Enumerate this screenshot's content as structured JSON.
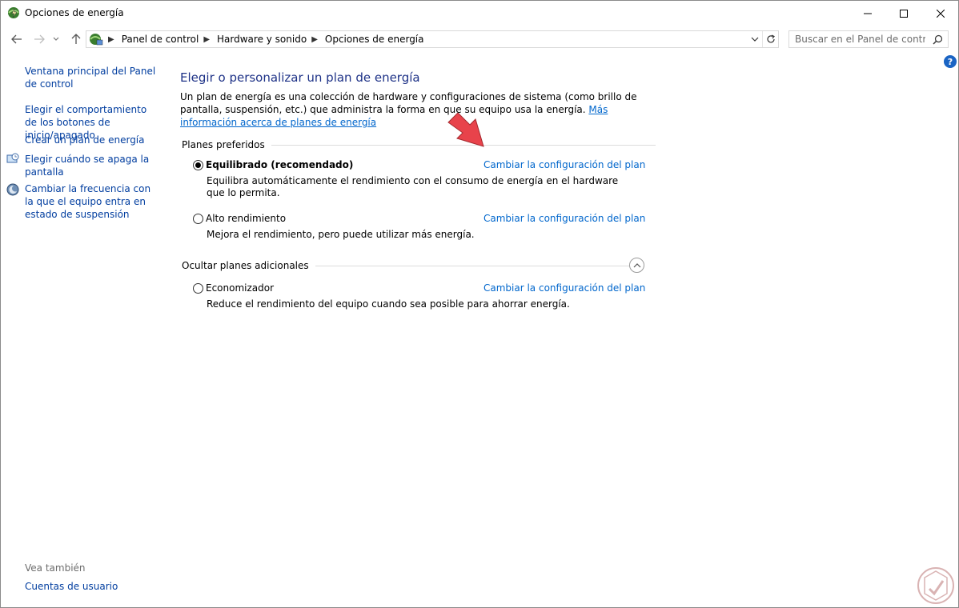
{
  "window": {
    "title": "Opciones de energía"
  },
  "nav": {
    "breadcrumbs": [
      "Panel de control",
      "Hardware y sonido",
      "Opciones de energía"
    ],
    "search_placeholder": "Buscar en el Panel de control"
  },
  "sidebar": {
    "items": [
      {
        "label": "Ventana principal del Panel de control"
      },
      {
        "label": "Elegir el comportamiento de los botones de inicio/apagado"
      },
      {
        "label": "Crear un plan de energía"
      },
      {
        "label": "Elegir cuándo se apaga la pantalla"
      },
      {
        "label": "Cambiar la frecuencia con la que el equipo entra en estado de suspensión"
      }
    ],
    "see_also": "Vea también",
    "user_accounts": "Cuentas de usuario"
  },
  "main": {
    "title": "Elegir o personalizar un plan de energía",
    "intro_text": "Un plan de energía es una colección de hardware y configuraciones de sistema (como brillo de pantalla, suspensión, etc.) que administra la forma en que su equipo usa la energía. ",
    "intro_link": "Más información acerca de planes de energía",
    "preferred_header": "Planes preferidos",
    "hidden_header": "Ocultar planes adicionales",
    "plans": [
      {
        "name": "Equilibrado (recomendado)",
        "description": "Equilibra automáticamente el rendimiento con el consumo de energía en el hardware que lo permita.",
        "link": "Cambiar la configuración del plan",
        "selected": true
      },
      {
        "name": "Alto rendimiento",
        "description": "Mejora el rendimiento, pero puede utilizar más energía.",
        "link": "Cambiar la configuración del plan",
        "selected": false
      },
      {
        "name": "Economizador",
        "description": "Reduce el rendimiento del equipo cuando sea posible para ahorrar energía.",
        "link": "Cambiar la configuración del plan",
        "selected": false
      }
    ]
  },
  "colors": {
    "link": "#0066cc",
    "sidebar_link": "#003d9f",
    "heading": "#1e3287",
    "annotation_arrow": "#e8434b"
  },
  "icons": {
    "app": "power-options-icon",
    "help": "help-icon",
    "search": "search-icon"
  }
}
